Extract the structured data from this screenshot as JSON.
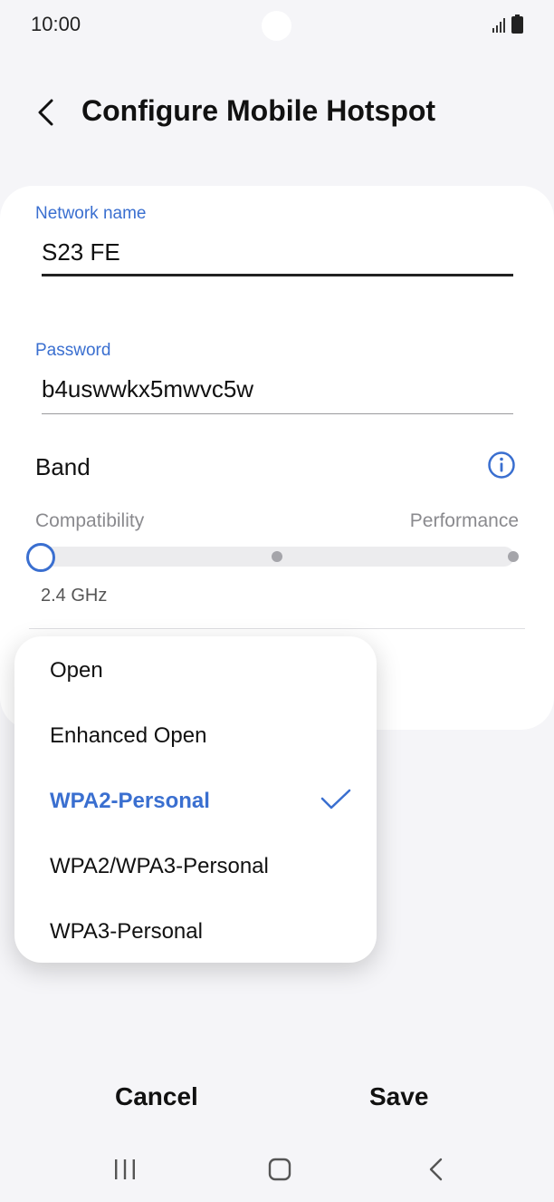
{
  "status_bar": {
    "time": "10:00",
    "icons": [
      "signal-icon",
      "battery-icon"
    ]
  },
  "header": {
    "title": "Configure Mobile Hotspot",
    "back_icon": "back-arrow-icon"
  },
  "form": {
    "network_name": {
      "label": "Network name",
      "value": "S23 FE"
    },
    "password": {
      "label": "Password",
      "value": "b4uswwkx5mwvc5w"
    },
    "band": {
      "label": "Band",
      "info_icon": "info-icon",
      "slider_left": "Compatibility",
      "slider_right": "Performance",
      "value": "2.4 GHz",
      "slider_position": 0
    }
  },
  "security_dropdown": {
    "options": [
      {
        "label": "Open"
      },
      {
        "label": "Enhanced Open"
      },
      {
        "label": "WPA2-Personal"
      },
      {
        "label": "WPA2/WPA3-Personal"
      },
      {
        "label": "WPA3-Personal"
      }
    ],
    "selected": "WPA2-Personal",
    "check_icon": "checkmark-icon"
  },
  "actions": {
    "cancel": "Cancel",
    "save": "Save"
  },
  "nav_bar": {
    "icons": [
      "recent-apps-icon",
      "home-icon",
      "back-icon"
    ]
  },
  "colors": {
    "accent": "#3a6fd0",
    "background": "#f5f5f8",
    "card": "#ffffff"
  }
}
